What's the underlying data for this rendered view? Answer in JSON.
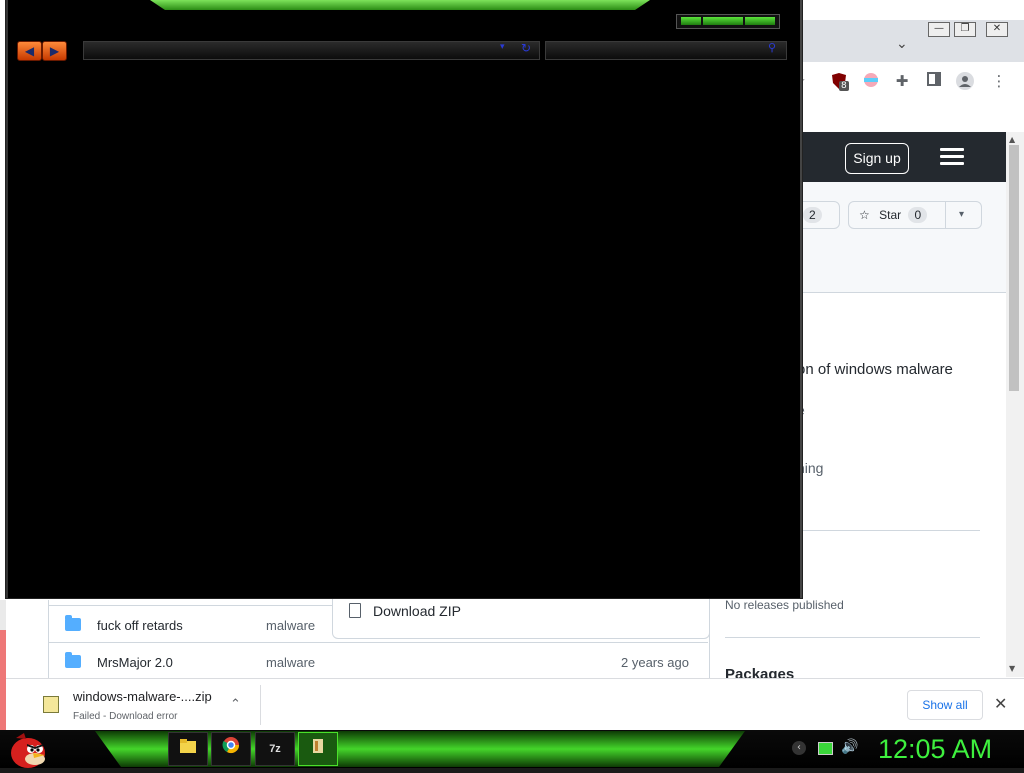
{
  "chrome": {
    "window_buttons": [
      "—",
      "❐",
      "✕"
    ],
    "tab_dropdown": "⌄",
    "toolbar_icons": [
      "star-icon",
      "ublock-icon",
      "extension-color-icon",
      "puzzle-icon",
      "sidepanel-icon",
      "profile-icon",
      "menu-icon"
    ],
    "ublock_badge": "8"
  },
  "github": {
    "signup_label": "Sign up",
    "fork_count": "2",
    "star_label": "Star",
    "star_count": "0",
    "about_text": "on of windows malware",
    "side_line1": "e",
    "side_line2": "ning",
    "releases_text": "No releases published",
    "packages_heading": "Packages",
    "download_zip_label": "Download ZIP",
    "files": [
      {
        "name": "fuck off retards",
        "commit": "malware",
        "age": ""
      },
      {
        "name": "MrsMajor 2.0",
        "commit": "malware",
        "age": "2 years ago"
      }
    ]
  },
  "download_bar": {
    "filename": "windows-malware-....zip",
    "status": "Failed - Download error",
    "show_all_label": "Show all"
  },
  "taskbar": {
    "clock": "12:05 AM",
    "accent": "#3ef03e"
  }
}
